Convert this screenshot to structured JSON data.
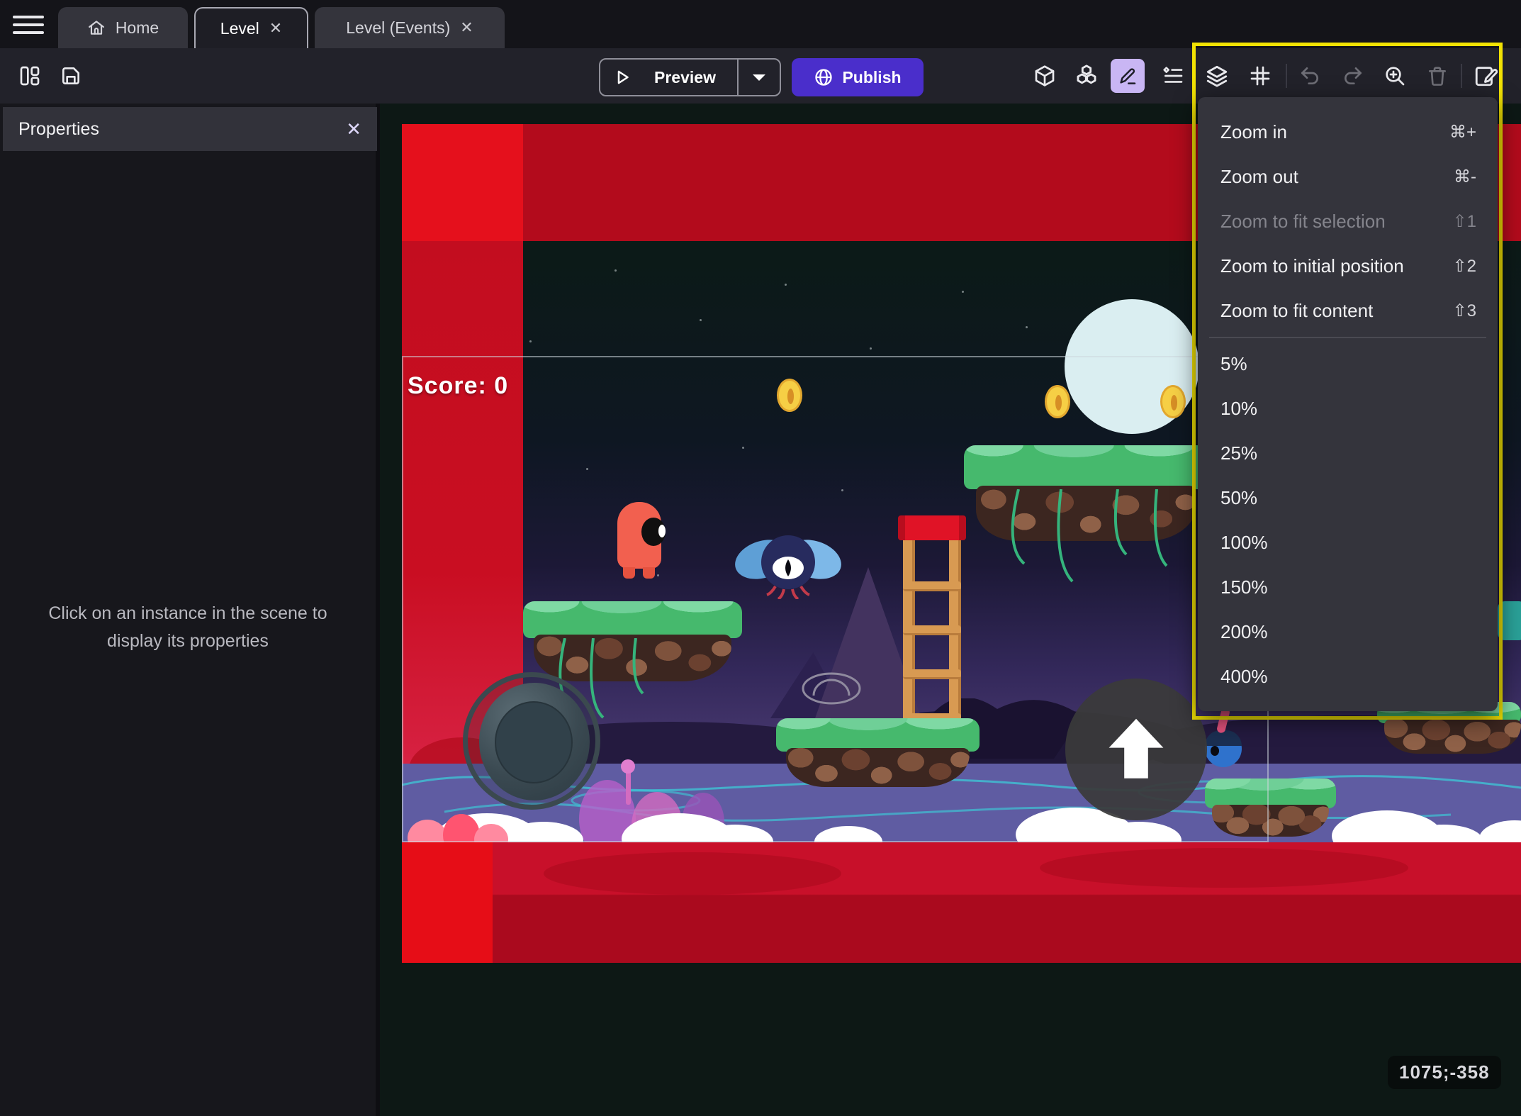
{
  "window": {
    "tabs": [
      {
        "label": "Home"
      },
      {
        "label": "Level"
      },
      {
        "label": "Level (Events)"
      }
    ]
  },
  "toolbar": {
    "preview_label": "Preview",
    "publish_label": "Publish",
    "icons": [
      "layout-icon",
      "save-icon",
      "cube-icon",
      "prefab-icon",
      "pencil-icon",
      "instance-list-icon",
      "layers-icon",
      "grid-icon",
      "undo-icon",
      "redo-icon",
      "zoom-in-icon",
      "trash-icon",
      "edit-scene-icon"
    ]
  },
  "properties_panel": {
    "title": "Properties",
    "hint": "Click on an instance in the scene to display its properties"
  },
  "zoom_menu": {
    "commands": [
      {
        "label": "Zoom in",
        "shortcut": "⌘+",
        "enabled": true
      },
      {
        "label": "Zoom out",
        "shortcut": "⌘-",
        "enabled": true
      },
      {
        "label": "Zoom to fit selection",
        "shortcut": "⇧1",
        "enabled": false
      },
      {
        "label": "Zoom to initial position",
        "shortcut": "⇧2",
        "enabled": true
      },
      {
        "label": "Zoom to fit content",
        "shortcut": "⇧3",
        "enabled": true
      }
    ],
    "zoom_levels": [
      "5%",
      "10%",
      "25%",
      "50%",
      "100%",
      "150%",
      "200%",
      "400%"
    ]
  },
  "scene": {
    "score_text": "Score: 0",
    "cursor_coordinates": "1075;-358"
  },
  "colors": {
    "accent_purple": "#4a2ecb",
    "selection_purple": "#c9b6f4",
    "highlight_yellow": "#f2e203",
    "band_red": "#c8102a",
    "menu_bg": "#34343c"
  }
}
